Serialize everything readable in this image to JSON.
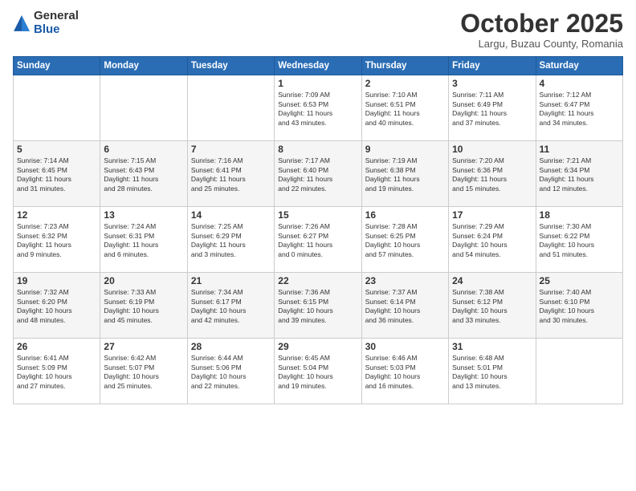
{
  "logo": {
    "general": "General",
    "blue": "Blue"
  },
  "header": {
    "month": "October 2025",
    "location": "Largu, Buzau County, Romania"
  },
  "weekdays": [
    "Sunday",
    "Monday",
    "Tuesday",
    "Wednesday",
    "Thursday",
    "Friday",
    "Saturday"
  ],
  "weeks": [
    [
      {
        "day": "",
        "info": ""
      },
      {
        "day": "",
        "info": ""
      },
      {
        "day": "",
        "info": ""
      },
      {
        "day": "1",
        "info": "Sunrise: 7:09 AM\nSunset: 6:53 PM\nDaylight: 11 hours\nand 43 minutes."
      },
      {
        "day": "2",
        "info": "Sunrise: 7:10 AM\nSunset: 6:51 PM\nDaylight: 11 hours\nand 40 minutes."
      },
      {
        "day": "3",
        "info": "Sunrise: 7:11 AM\nSunset: 6:49 PM\nDaylight: 11 hours\nand 37 minutes."
      },
      {
        "day": "4",
        "info": "Sunrise: 7:12 AM\nSunset: 6:47 PM\nDaylight: 11 hours\nand 34 minutes."
      }
    ],
    [
      {
        "day": "5",
        "info": "Sunrise: 7:14 AM\nSunset: 6:45 PM\nDaylight: 11 hours\nand 31 minutes."
      },
      {
        "day": "6",
        "info": "Sunrise: 7:15 AM\nSunset: 6:43 PM\nDaylight: 11 hours\nand 28 minutes."
      },
      {
        "day": "7",
        "info": "Sunrise: 7:16 AM\nSunset: 6:41 PM\nDaylight: 11 hours\nand 25 minutes."
      },
      {
        "day": "8",
        "info": "Sunrise: 7:17 AM\nSunset: 6:40 PM\nDaylight: 11 hours\nand 22 minutes."
      },
      {
        "day": "9",
        "info": "Sunrise: 7:19 AM\nSunset: 6:38 PM\nDaylight: 11 hours\nand 19 minutes."
      },
      {
        "day": "10",
        "info": "Sunrise: 7:20 AM\nSunset: 6:36 PM\nDaylight: 11 hours\nand 15 minutes."
      },
      {
        "day": "11",
        "info": "Sunrise: 7:21 AM\nSunset: 6:34 PM\nDaylight: 11 hours\nand 12 minutes."
      }
    ],
    [
      {
        "day": "12",
        "info": "Sunrise: 7:23 AM\nSunset: 6:32 PM\nDaylight: 11 hours\nand 9 minutes."
      },
      {
        "day": "13",
        "info": "Sunrise: 7:24 AM\nSunset: 6:31 PM\nDaylight: 11 hours\nand 6 minutes."
      },
      {
        "day": "14",
        "info": "Sunrise: 7:25 AM\nSunset: 6:29 PM\nDaylight: 11 hours\nand 3 minutes."
      },
      {
        "day": "15",
        "info": "Sunrise: 7:26 AM\nSunset: 6:27 PM\nDaylight: 11 hours\nand 0 minutes."
      },
      {
        "day": "16",
        "info": "Sunrise: 7:28 AM\nSunset: 6:25 PM\nDaylight: 10 hours\nand 57 minutes."
      },
      {
        "day": "17",
        "info": "Sunrise: 7:29 AM\nSunset: 6:24 PM\nDaylight: 10 hours\nand 54 minutes."
      },
      {
        "day": "18",
        "info": "Sunrise: 7:30 AM\nSunset: 6:22 PM\nDaylight: 10 hours\nand 51 minutes."
      }
    ],
    [
      {
        "day": "19",
        "info": "Sunrise: 7:32 AM\nSunset: 6:20 PM\nDaylight: 10 hours\nand 48 minutes."
      },
      {
        "day": "20",
        "info": "Sunrise: 7:33 AM\nSunset: 6:19 PM\nDaylight: 10 hours\nand 45 minutes."
      },
      {
        "day": "21",
        "info": "Sunrise: 7:34 AM\nSunset: 6:17 PM\nDaylight: 10 hours\nand 42 minutes."
      },
      {
        "day": "22",
        "info": "Sunrise: 7:36 AM\nSunset: 6:15 PM\nDaylight: 10 hours\nand 39 minutes."
      },
      {
        "day": "23",
        "info": "Sunrise: 7:37 AM\nSunset: 6:14 PM\nDaylight: 10 hours\nand 36 minutes."
      },
      {
        "day": "24",
        "info": "Sunrise: 7:38 AM\nSunset: 6:12 PM\nDaylight: 10 hours\nand 33 minutes."
      },
      {
        "day": "25",
        "info": "Sunrise: 7:40 AM\nSunset: 6:10 PM\nDaylight: 10 hours\nand 30 minutes."
      }
    ],
    [
      {
        "day": "26",
        "info": "Sunrise: 6:41 AM\nSunset: 5:09 PM\nDaylight: 10 hours\nand 27 minutes."
      },
      {
        "day": "27",
        "info": "Sunrise: 6:42 AM\nSunset: 5:07 PM\nDaylight: 10 hours\nand 25 minutes."
      },
      {
        "day": "28",
        "info": "Sunrise: 6:44 AM\nSunset: 5:06 PM\nDaylight: 10 hours\nand 22 minutes."
      },
      {
        "day": "29",
        "info": "Sunrise: 6:45 AM\nSunset: 5:04 PM\nDaylight: 10 hours\nand 19 minutes."
      },
      {
        "day": "30",
        "info": "Sunrise: 6:46 AM\nSunset: 5:03 PM\nDaylight: 10 hours\nand 16 minutes."
      },
      {
        "day": "31",
        "info": "Sunrise: 6:48 AM\nSunset: 5:01 PM\nDaylight: 10 hours\nand 13 minutes."
      },
      {
        "day": "",
        "info": ""
      }
    ]
  ]
}
